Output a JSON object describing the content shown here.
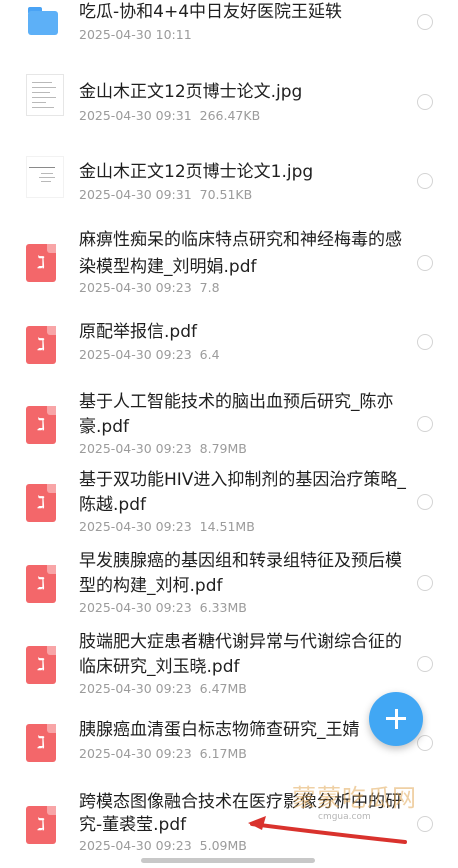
{
  "files": [
    {
      "type": "folder",
      "icon": "folder-icon",
      "title_lines": [
        "吃瓜-协和4+4中日友好医院王延轶"
      ],
      "date": "2025-04-30 10:11",
      "size": ""
    },
    {
      "type": "image",
      "icon": "image-thumbnail-icon",
      "title_lines": [
        "金山木正文12页博士论文.jpg"
      ],
      "date": "2025-04-30 09:31",
      "size": "266.47KB"
    },
    {
      "type": "image",
      "icon": "image-thumbnail-icon",
      "title_lines": [
        "金山木正文12页博士论文1.jpg"
      ],
      "date": "2025-04-30 09:31",
      "size": "70.51KB"
    },
    {
      "type": "pdf",
      "icon": "pdf-icon",
      "title_lines": [
        "麻痹性痴呆的临床特点研究和神经梅毒的感",
        "染模型构建_刘明娟.pdf"
      ],
      "date": "2025-04-30 09:23",
      "size": "7.8"
    },
    {
      "type": "pdf",
      "icon": "pdf-icon",
      "title_lines": [
        "原配举报信.pdf"
      ],
      "date": "2025-04-30 09:23",
      "size": "6.4"
    },
    {
      "type": "pdf",
      "icon": "pdf-icon",
      "title_lines": [
        "基于人工智能技术的脑出血预后研究_陈亦",
        "豪.pdf"
      ],
      "date": "2025-04-30 09:23",
      "size": "8.79MB"
    },
    {
      "type": "pdf",
      "icon": "pdf-icon",
      "title_lines": [
        "基于双功能HIV进入抑制剂的基因治疗策略_",
        "陈越.pdf"
      ],
      "date": "2025-04-30 09:23",
      "size": "14.51MB"
    },
    {
      "type": "pdf",
      "icon": "pdf-icon",
      "title_lines": [
        "早发胰腺癌的基因组和转录组特征及预后模",
        "型的构建_刘柯.pdf"
      ],
      "date": "2025-04-30 09:23",
      "size": "6.33MB"
    },
    {
      "type": "pdf",
      "icon": "pdf-icon",
      "title_lines": [
        "肢端肥大症患者糖代谢异常与代谢综合征的",
        "临床研究_刘玉晓.pdf"
      ],
      "date": "2025-04-30 09:23",
      "size": "6.47MB"
    },
    {
      "type": "pdf",
      "icon": "pdf-icon",
      "title_lines": [
        "胰腺癌血清蛋白标志物筛查研究_王婧",
        "",
        ""
      ],
      "date": "2025-04-30 09:23",
      "size": "6.17MB"
    },
    {
      "type": "pdf",
      "icon": "pdf-icon",
      "title_lines": [
        "跨模态图像融合技术在医疗影像分析中的研",
        "究-董裘莹.pdf"
      ],
      "date": "2025-04-30 09:23",
      "size": "5.09MB"
    }
  ],
  "pdf_glyph": "ℷ",
  "fab": {
    "icon": "plus-icon",
    "color": "#41a7f4"
  },
  "watermark": {
    "text": "蒙蒙吃瓜网",
    "url": "cmgua.com"
  },
  "colors": {
    "pdf": "#f3676a",
    "folder": "#5db0f7",
    "title": "#1f1f1f",
    "meta": "#9b9b9b"
  }
}
